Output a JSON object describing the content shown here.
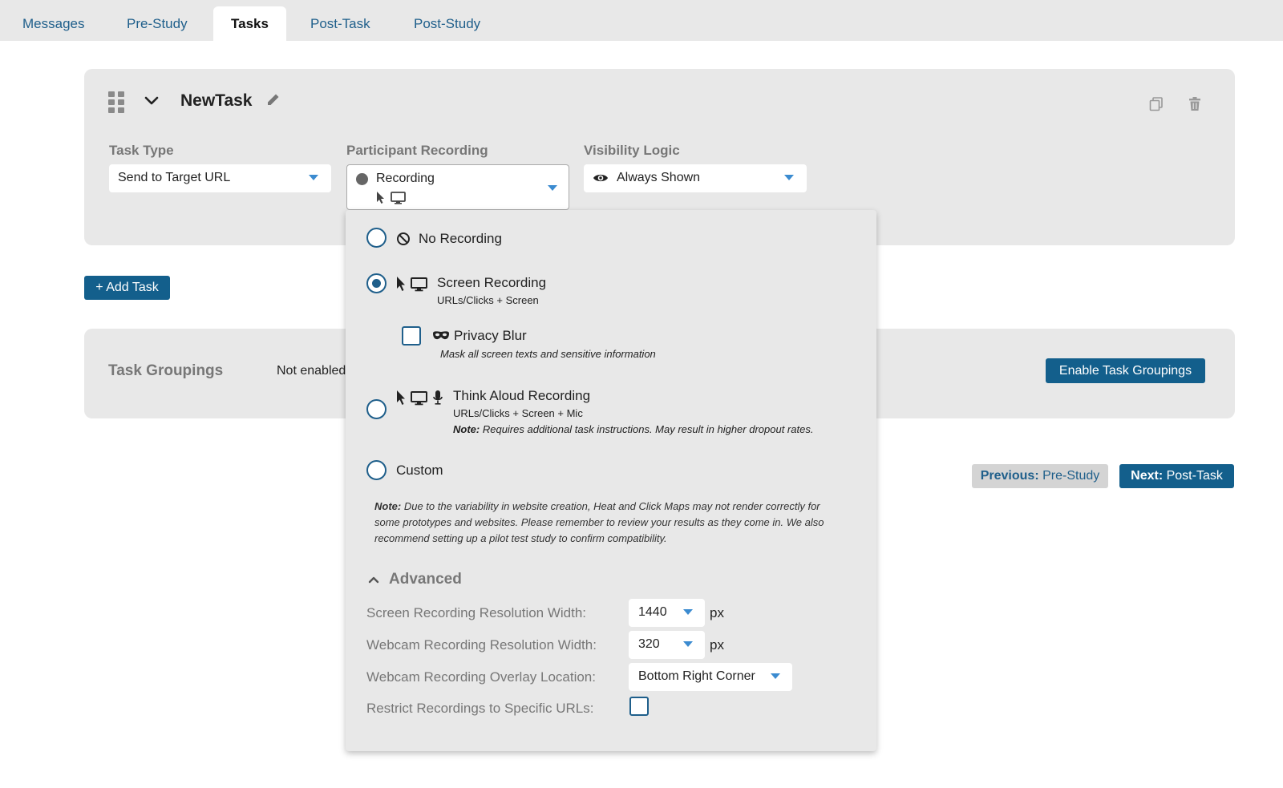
{
  "tabs": [
    {
      "label": "Messages"
    },
    {
      "label": "Pre-Study"
    },
    {
      "label": "Tasks"
    },
    {
      "label": "Post-Task"
    },
    {
      "label": "Post-Study"
    }
  ],
  "task": {
    "name": "NewTask",
    "task_type": {
      "label": "Task Type",
      "value": "Send to Target URL"
    },
    "participant_recording": {
      "label": "Participant Recording",
      "value": "Recording"
    },
    "visibility_logic": {
      "label": "Visibility Logic",
      "value": "Always Shown"
    }
  },
  "add_task_label": "+ Add Task",
  "task_groupings": {
    "title": "Task Groupings",
    "status": "Not enabled",
    "enable_label": "Enable Task Groupings"
  },
  "navigation": {
    "previous_prefix": "Previous:",
    "previous_target": "Pre-Study",
    "next_prefix": "Next:",
    "next_target": "Post-Task"
  },
  "recording_menu": {
    "options": [
      {
        "title": "No Recording",
        "selected": false
      },
      {
        "title": "Screen Recording",
        "subtitle": "URLs/Clicks + Screen",
        "selected": true
      },
      {
        "title": "Think Aloud Recording",
        "subtitle": "URLs/Clicks + Screen + Mic",
        "note_label": "Note:",
        "note": "Requires additional task instructions. May result in higher dropout rates.",
        "selected": false
      },
      {
        "title": "Custom",
        "selected": false
      }
    ],
    "privacy_blur": {
      "title": "Privacy Blur",
      "description": "Mask all screen texts and sensitive information",
      "checked": false
    },
    "note_label": "Note:",
    "note_line1": "Due to the variability in website creation, Heat and Click Maps may not render correctly for",
    "note_line2": "some prototypes and websites. Please remember to review your results as they come in. We also",
    "note_line3": "recommend setting up a pilot test study to confirm compatibility.",
    "advanced": {
      "title": "Advanced",
      "screen_width": {
        "label": "Screen Recording Resolution Width:",
        "value": "1440",
        "unit": "px"
      },
      "webcam_width": {
        "label": "Webcam Recording Resolution Width:",
        "value": "320",
        "unit": "px"
      },
      "overlay_location": {
        "label": "Webcam Recording Overlay Location:",
        "value": "Bottom Right Corner"
      },
      "restrict_urls": {
        "label": "Restrict Recordings to Specific URLs:",
        "checked": false
      }
    }
  },
  "colors": {
    "accent": "#135f8c",
    "link": "#1f5f8b",
    "panel_bg": "#e8e8e8",
    "caret": "#3b8bd0"
  }
}
